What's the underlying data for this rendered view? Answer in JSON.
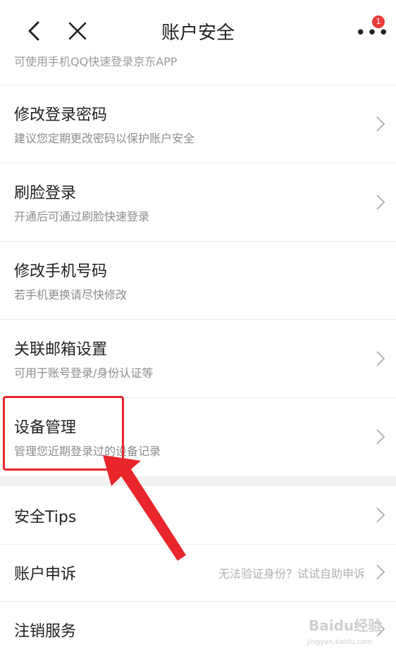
{
  "header": {
    "title": "账户安全",
    "badge_count": "1"
  },
  "partial_row_text": "可使用手机QQ快速登录京东APP",
  "items": [
    {
      "title": "修改登录密码",
      "subtitle": "建议您定期更改密码以保护账户安全"
    },
    {
      "title": "刷脸登录",
      "subtitle": "开通后可通过刷脸快速登录"
    },
    {
      "title": "修改手机号码",
      "subtitle": "若手机更换请尽快修改"
    },
    {
      "title": "关联邮箱设置",
      "subtitle": "可用于账号登录/身份认证等"
    },
    {
      "title": "设备管理",
      "subtitle": "管理您近期登录过的设备记录"
    }
  ],
  "section2": [
    {
      "title": "安全Tips"
    },
    {
      "title": "账户申诉",
      "hint": "无法验证身份？试试自助申诉"
    },
    {
      "title": "注销服务"
    }
  ],
  "watermark": {
    "text": "Baidu经验",
    "url": "jingyan.baidu.com"
  },
  "colors": {
    "highlight": "#e8262b",
    "badge": "#e93b3b"
  }
}
